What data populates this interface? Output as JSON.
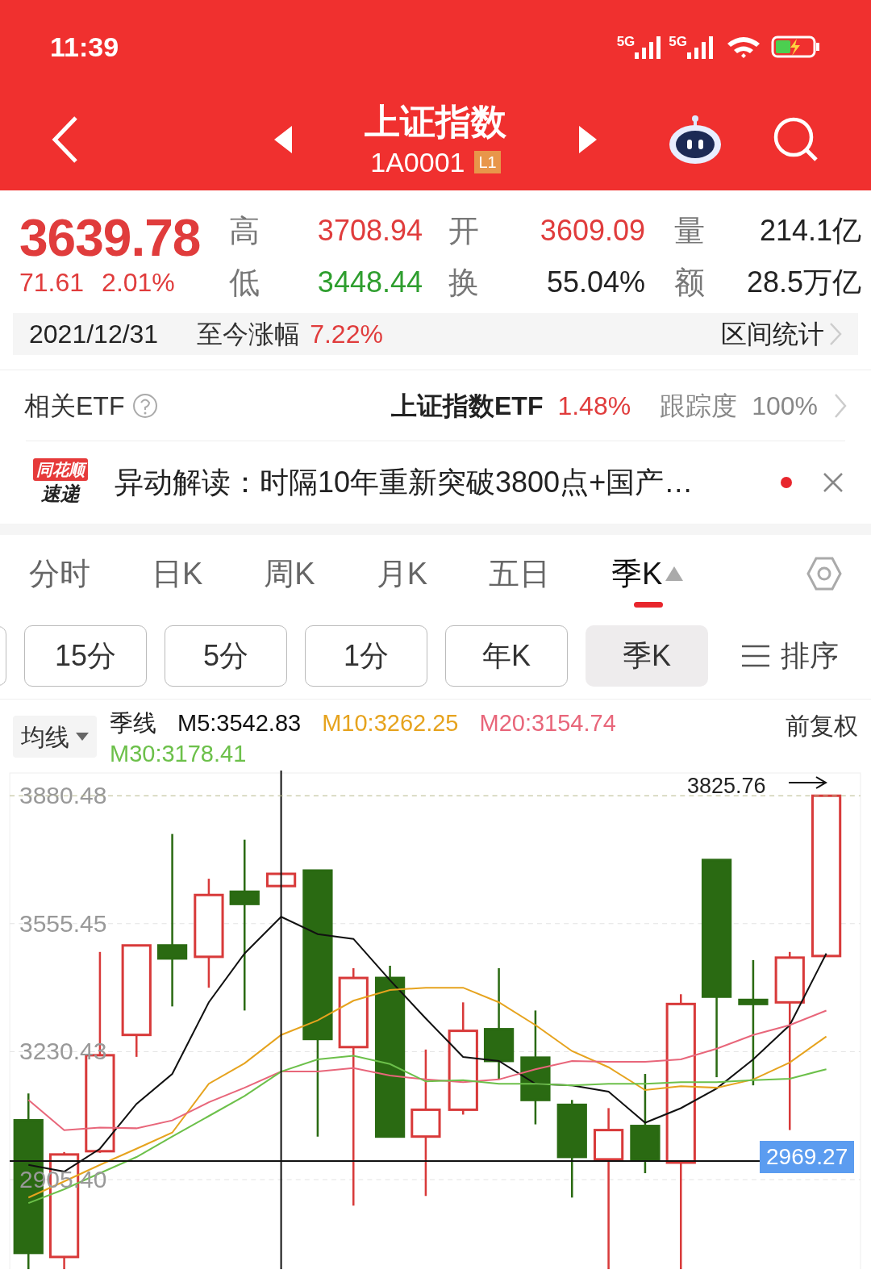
{
  "status_bar": {
    "time": "11:39",
    "networks": [
      "5G",
      "5G"
    ]
  },
  "header": {
    "title": "上证指数",
    "code": "1A0001",
    "level_badge": "L1"
  },
  "quote": {
    "price": "3639.78",
    "change": "71.61",
    "change_pct": "2.01%",
    "stats": [
      {
        "label": "高",
        "value": "3708.94",
        "color": "#e03c3c"
      },
      {
        "label": "开",
        "value": "3609.09",
        "color": "#e03c3c"
      },
      {
        "label": "量",
        "value": "214.1亿",
        "color": "#222222"
      },
      {
        "label": "低",
        "value": "3448.44",
        "color": "#2e9e2e"
      },
      {
        "label": "换",
        "value": "55.04%",
        "color": "#222222"
      },
      {
        "label": "额",
        "value": "28.5万亿",
        "color": "#222222"
      }
    ]
  },
  "period_bar": {
    "date": "2021/12/31",
    "label": "至今涨幅",
    "value": "7.22%",
    "link": "区间统计"
  },
  "etf": {
    "label": "相关ETF",
    "name": "上证指数ETF",
    "change": "1.48%",
    "tracking_label": "跟踪度",
    "tracking_value": "100%"
  },
  "news": {
    "badge_top": "同花顺",
    "badge_bottom": "速递",
    "text": "异动解读：时隔10年重新突破3800点+国产…",
    "unread": true
  },
  "period_tabs": [
    {
      "label": "分时",
      "selected": false
    },
    {
      "label": "日K",
      "selected": false
    },
    {
      "label": "周K",
      "selected": false
    },
    {
      "label": "月K",
      "selected": false
    },
    {
      "label": "五日",
      "selected": false
    },
    {
      "label": "季K",
      "selected": true
    }
  ],
  "sub_tabs": [
    {
      "label": "15分",
      "selected": false
    },
    {
      "label": "5分",
      "selected": false
    },
    {
      "label": "1分",
      "selected": false
    },
    {
      "label": "年K",
      "selected": false
    },
    {
      "label": "季K",
      "selected": true
    }
  ],
  "sort_label": "排序",
  "ma_legend": {
    "selector": "均线",
    "type": "季线",
    "adjust": "前复权"
  },
  "chart": {
    "high_label": "3825.76",
    "crosshair_value": "2969.27",
    "chart_data": {
      "type": "line",
      "ylim": [
        2678.2,
        3944.5
      ],
      "yticks": [
        {
          "value": 2905.4,
          "label": "2905.40"
        },
        {
          "value": 3230.43,
          "label": "3230.43"
        },
        {
          "value": 3555.45,
          "label": "3555.45"
        },
        {
          "value": 3880.48,
          "label": "3880.48"
        }
      ],
      "grid": true,
      "series": [
        {
          "name": "M5:3542.83",
          "color": "#111111",
          "values": [
            2943,
            2926,
            2984,
            3098,
            3174,
            3356,
            3480,
            3573,
            3529,
            3517,
            3412,
            3315,
            3217,
            3207,
            3149,
            3145,
            3129,
            3050,
            3087,
            3137,
            3211,
            3298,
            3480
          ]
        },
        {
          "name": "M10:3262.25",
          "color": "#e6a31e",
          "values": [
            2860,
            2901,
            2943,
            2984,
            3025,
            3149,
            3201,
            3273,
            3310,
            3360,
            3387,
            3393,
            3393,
            3356,
            3298,
            3232,
            3191,
            3133,
            3143,
            3139,
            3160,
            3203,
            3269
          ]
        },
        {
          "name": "M20:3154.74",
          "color": "#e8667a",
          "values": [
            3108,
            3031,
            3038,
            3036,
            3056,
            3102,
            3139,
            3180,
            3180,
            3189,
            3170,
            3160,
            3153,
            3160,
            3186,
            3207,
            3205,
            3205,
            3211,
            3238,
            3273,
            3298,
            3335
          ]
        },
        {
          "name": "M30:3178.41",
          "color": "#6cc04a",
          "values": [
            2846,
            2881,
            2922,
            2963,
            3015,
            3067,
            3118,
            3180,
            3211,
            3220,
            3199,
            3155,
            3158,
            3149,
            3149,
            3145,
            3149,
            3149,
            3153,
            3153,
            3158,
            3162,
            3186
          ]
        }
      ]
    }
  }
}
